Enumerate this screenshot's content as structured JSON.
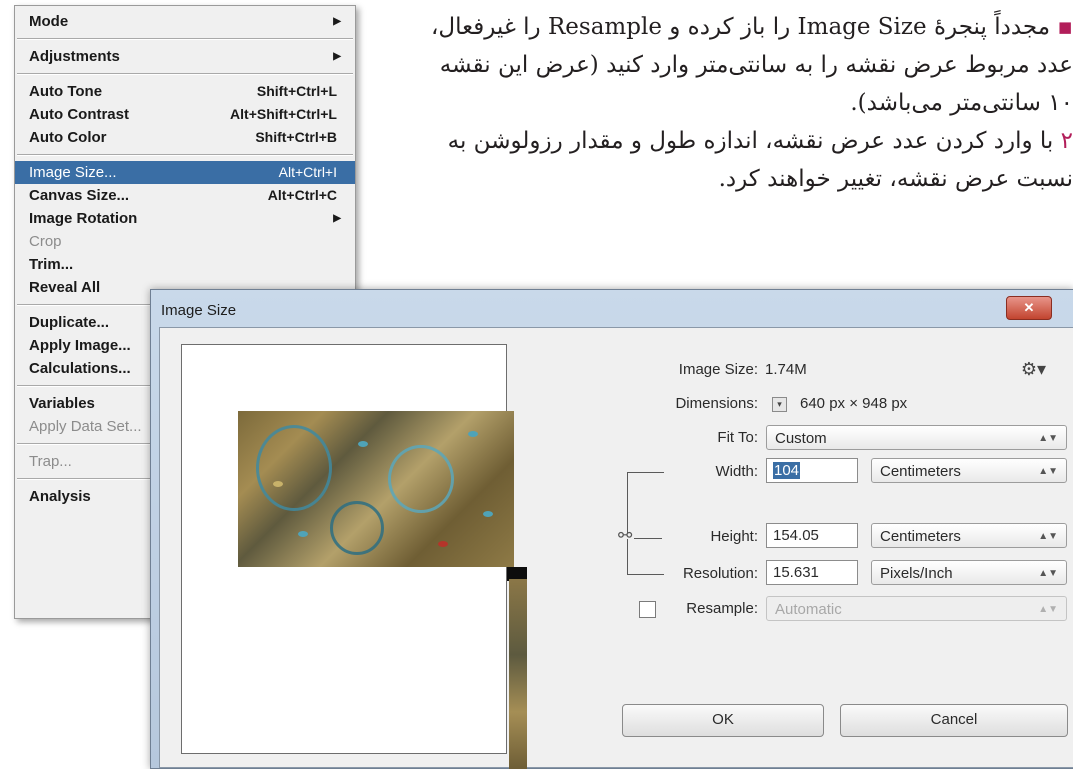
{
  "instructions": {
    "bullet": "▪",
    "line1": "مجدداً پنجرهٔ Image Size را باز کرده و Resample را غیرفعال،",
    "line2": "عدد مربوط عرض نقشه را به سانتی‌متر وارد کنید (عرض این نقشه",
    "line3": "۱۰ سانتی‌متر می‌باشد).",
    "step_number": "۲",
    "line4": " با وارد کردن عدد عرض نقشه، اندازه طول و مقدار رزولوشن به",
    "line5": "نسبت عرض نقشه، تغییر خواهند کرد."
  },
  "menu": {
    "mode": "Mode",
    "adjustments": "Adjustments",
    "auto_tone": "Auto Tone",
    "auto_tone_sc": "Shift+Ctrl+L",
    "auto_contrast": "Auto Contrast",
    "auto_contrast_sc": "Alt+Shift+Ctrl+L",
    "auto_color": "Auto Color",
    "auto_color_sc": "Shift+Ctrl+B",
    "image_size": "Image Size...",
    "image_size_sc": "Alt+Ctrl+I",
    "canvas_size": "Canvas Size...",
    "canvas_size_sc": "Alt+Ctrl+C",
    "image_rotation": "Image Rotation",
    "crop": "Crop",
    "trim": "Trim...",
    "reveal_all": "Reveal All",
    "duplicate": "Duplicate...",
    "apply_image": "Apply Image...",
    "calculations": "Calculations...",
    "variables": "Variables",
    "apply_data_set": "Apply Data Set...",
    "trap": "Trap...",
    "analysis": "Analysis"
  },
  "dialog": {
    "title": "Image Size",
    "close_glyph": "✕",
    "image_size_label": "Image Size:",
    "image_size_value": "1.74M",
    "dimensions_label": "Dimensions:",
    "dimensions_value": "640 px  ×  948 px",
    "fit_to_label": "Fit To:",
    "fit_to_value": "Custom",
    "width_label": "Width:",
    "width_value": "104",
    "width_unit": "Centimeters",
    "height_label": "Height:",
    "height_value": "154.05",
    "height_unit": "Centimeters",
    "resolution_label": "Resolution:",
    "resolution_value": "15.631",
    "resolution_unit": "Pixels/Inch",
    "resample_label": "Resample:",
    "resample_value": "Automatic",
    "resample_checked": false,
    "ok_label": "OK",
    "cancel_label": "Cancel",
    "gear_glyph": "⚙▾",
    "arrow_glyph": "▲▼",
    "menu_arrow_glyph": "▶",
    "chain_glyph": "⚯",
    "dim_toggle_glyph": "▾"
  }
}
